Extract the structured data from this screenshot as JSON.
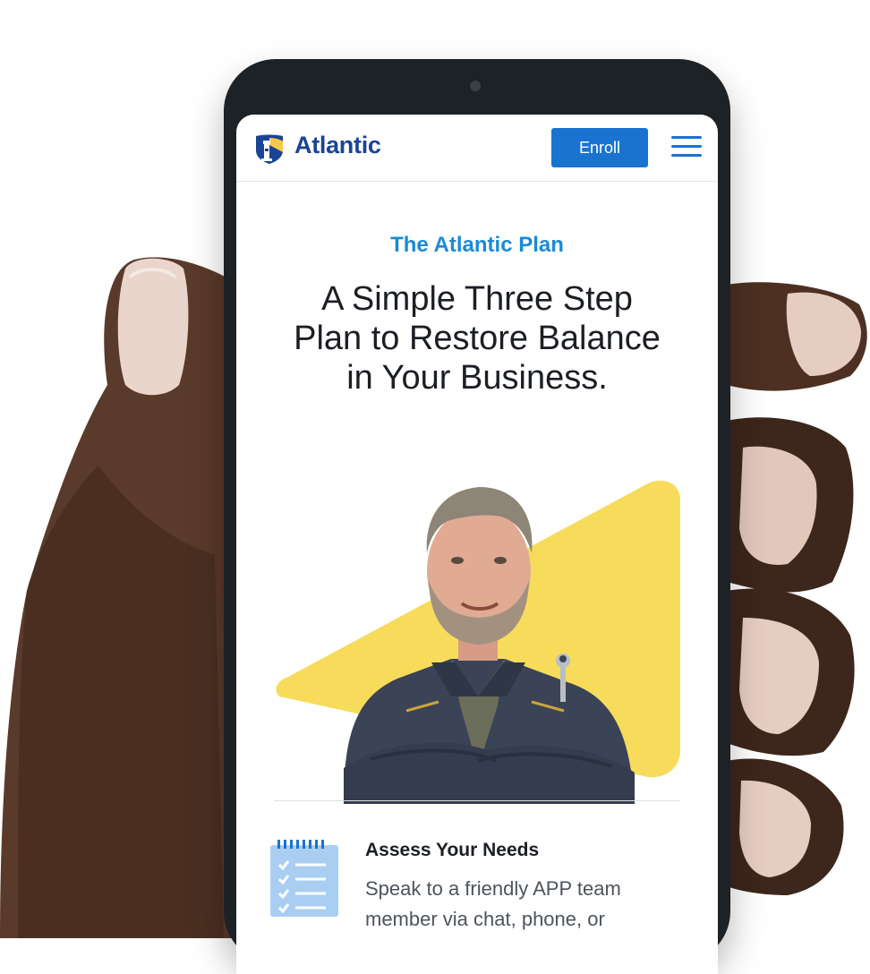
{
  "nav": {
    "brand": "Atlantic",
    "enroll_label": "Enroll"
  },
  "hero": {
    "eyebrow": "The Atlantic Plan",
    "headline_lines": [
      "A Simple Three Step",
      "Plan to Restore Balance",
      "in Your Business."
    ]
  },
  "step": {
    "title": "Assess Your Needs",
    "description_lines": [
      "Speak to a friendly APP team",
      "member via chat, phone, or"
    ]
  },
  "icons": {
    "logo": "lighthouse-shield-icon",
    "menu": "hamburger-menu-icon",
    "step": "checklist-notepad-icon"
  },
  "colors": {
    "brand_navy": "#1a4594",
    "accent_blue": "#1a73d1",
    "eyebrow_blue": "#1a8ad8",
    "highlight_yellow": "#f7dc5c",
    "phone_bezel": "#1d2227"
  }
}
